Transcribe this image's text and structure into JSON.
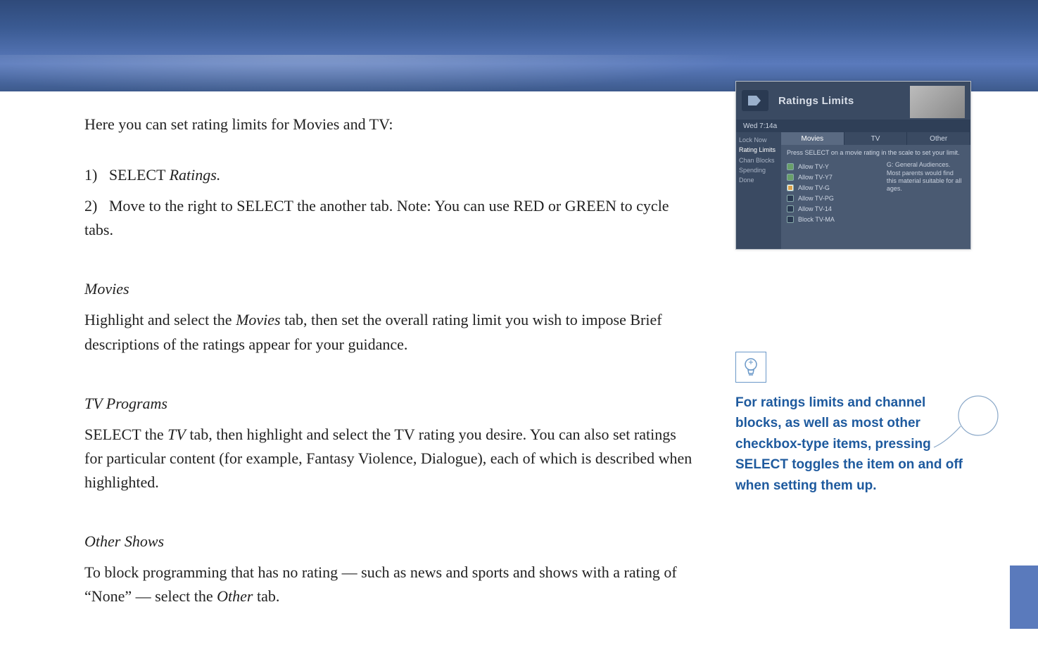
{
  "intro": "Here you can set rating limits for Movies and TV:",
  "steps": {
    "s1_prefix": "1)   SELECT ",
    "s1_em": "Ratings.",
    "s2": "2)   Move to the right to SELECT the another tab. Note: You can use RED or GREEN to cycle tabs."
  },
  "sections": {
    "movies_h": "Movies",
    "movies_p_a": "Highlight and select the ",
    "movies_p_em": "Movies",
    "movies_p_b": " tab, then set the overall rating limit you wish to impose Brief descriptions of the ratings appear for your guidance.",
    "tv_h": "TV Programs",
    "tv_p_a": "SELECT the ",
    "tv_p_em": "TV",
    "tv_p_b": " tab, then highlight and select the TV rating you desire. You can also set ratings for particular content (for example, Fantasy Violence, Dialogue), each of which is described when highlighted.",
    "other_h": "Other Shows",
    "other_p_a": "To block programming that has no rating — such as news and sports and shows with a rating of “None” — select the ",
    "other_p_em": "Other",
    "other_p_b": " tab."
  },
  "tip": {
    "text": "For ratings limits and channel blocks, as well as most other checkbox-type items, pressing SELECT toggles the item on and off when setting them up."
  },
  "screenshot": {
    "title": "Ratings Limits",
    "time": "Wed 7:14a",
    "side": {
      "lock_now": "Lock Now",
      "ratings": "Rating Limits",
      "chan": "Chan Blocks",
      "spend": "Spending",
      "done": "Done"
    },
    "tabs": {
      "movies": "Movies",
      "tv": "TV",
      "other": "Other"
    },
    "instr": "Press SELECT on a movie rating in the scale to set your limit.",
    "list": {
      "r0": "Allow TV-Y",
      "r1": "Allow TV-Y7",
      "r2": "Allow TV-G",
      "r3": "Allow TV-PG",
      "r4": "Allow TV-14",
      "r5": "Block TV-MA"
    },
    "desc": "G: General Audiences. Most parents would find this material suitable for all ages."
  }
}
